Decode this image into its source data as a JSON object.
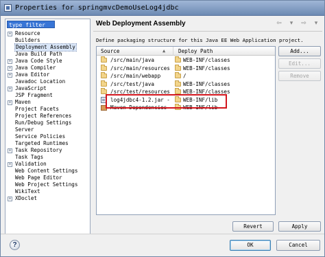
{
  "window": {
    "title": "Properties for springmvcDemoUseLog4jdbc"
  },
  "filter": {
    "value": "type filter text"
  },
  "tree": {
    "items": [
      {
        "label": "Resource",
        "expandable": true,
        "twisty": "+"
      },
      {
        "label": "Builders",
        "expandable": false
      },
      {
        "label": "Deployment Assembly",
        "expandable": false,
        "selected": true
      },
      {
        "label": "Java Build Path",
        "expandable": false
      },
      {
        "label": "Java Code Style",
        "expandable": true,
        "twisty": "+"
      },
      {
        "label": "Java Compiler",
        "expandable": true,
        "twisty": "+"
      },
      {
        "label": "Java Editor",
        "expandable": true,
        "twisty": "+"
      },
      {
        "label": "Javadoc Location",
        "expandable": false
      },
      {
        "label": "JavaScript",
        "expandable": true,
        "twisty": "+"
      },
      {
        "label": "JSP Fragment",
        "expandable": false
      },
      {
        "label": "Maven",
        "expandable": true,
        "twisty": "+"
      },
      {
        "label": "Project Facets",
        "expandable": false
      },
      {
        "label": "Project References",
        "expandable": false
      },
      {
        "label": "Run/Debug Settings",
        "expandable": false
      },
      {
        "label": "Server",
        "expandable": false
      },
      {
        "label": "Service Policies",
        "expandable": false
      },
      {
        "label": "Targeted Runtimes",
        "expandable": false
      },
      {
        "label": "Task Repository",
        "expandable": true,
        "twisty": "+"
      },
      {
        "label": "Task Tags",
        "expandable": false
      },
      {
        "label": "Validation",
        "expandable": true,
        "twisty": "+"
      },
      {
        "label": "Web Content Settings",
        "expandable": false
      },
      {
        "label": "Web Page Editor",
        "expandable": false
      },
      {
        "label": "Web Project Settings",
        "expandable": false
      },
      {
        "label": "WikiText",
        "expandable": false
      },
      {
        "label": "XDoclet",
        "expandable": true,
        "twisty": "+"
      }
    ]
  },
  "page": {
    "title": "Web Deployment Assembly",
    "description": "Define packaging structure for this Java EE Web Application project.",
    "nav": {
      "back": "⇦",
      "back_menu": "▾",
      "forward": "⇨",
      "forward_menu": "▾"
    }
  },
  "table": {
    "headers": {
      "source": "Source",
      "deploy": "Deploy Path",
      "sort_indicator": "▲"
    },
    "rows": [
      {
        "source": "/src/main/java",
        "deploy": "WEB-INF/classes",
        "source_icon": "folder-icon",
        "deploy_icon": "folder-icon"
      },
      {
        "source": "/src/main/resources",
        "deploy": "WEB-INF/classes",
        "source_icon": "folder-icon",
        "deploy_icon": "folder-icon"
      },
      {
        "source": "/src/main/webapp",
        "deploy": "/",
        "source_icon": "folder-icon",
        "deploy_icon": "folder-icon"
      },
      {
        "source": "/src/test/java",
        "deploy": "WEB-INF/classes",
        "source_icon": "folder-icon",
        "deploy_icon": "folder-icon"
      },
      {
        "source": "/src/test/resources",
        "deploy": "WEB-INF/classes",
        "source_icon": "folder-icon",
        "deploy_icon": "folder-icon"
      },
      {
        "source": "log4jdbc4-1.2.jar - '",
        "deploy": "WEB-INF/lib",
        "source_icon": "jar-icon",
        "deploy_icon": "folder-icon"
      },
      {
        "source": "Maven Dependencies",
        "deploy": "WEB-INF/lib",
        "source_icon": "library-icon",
        "deploy_icon": "folder-icon"
      }
    ]
  },
  "buttons": {
    "add": "Add...",
    "edit": "Edit...",
    "remove": "Remove",
    "revert": "Revert",
    "apply": "Apply",
    "ok": "OK",
    "cancel": "Cancel"
  },
  "colors": {
    "highlight_box": "#d2141c",
    "selection": "#3875d6"
  }
}
